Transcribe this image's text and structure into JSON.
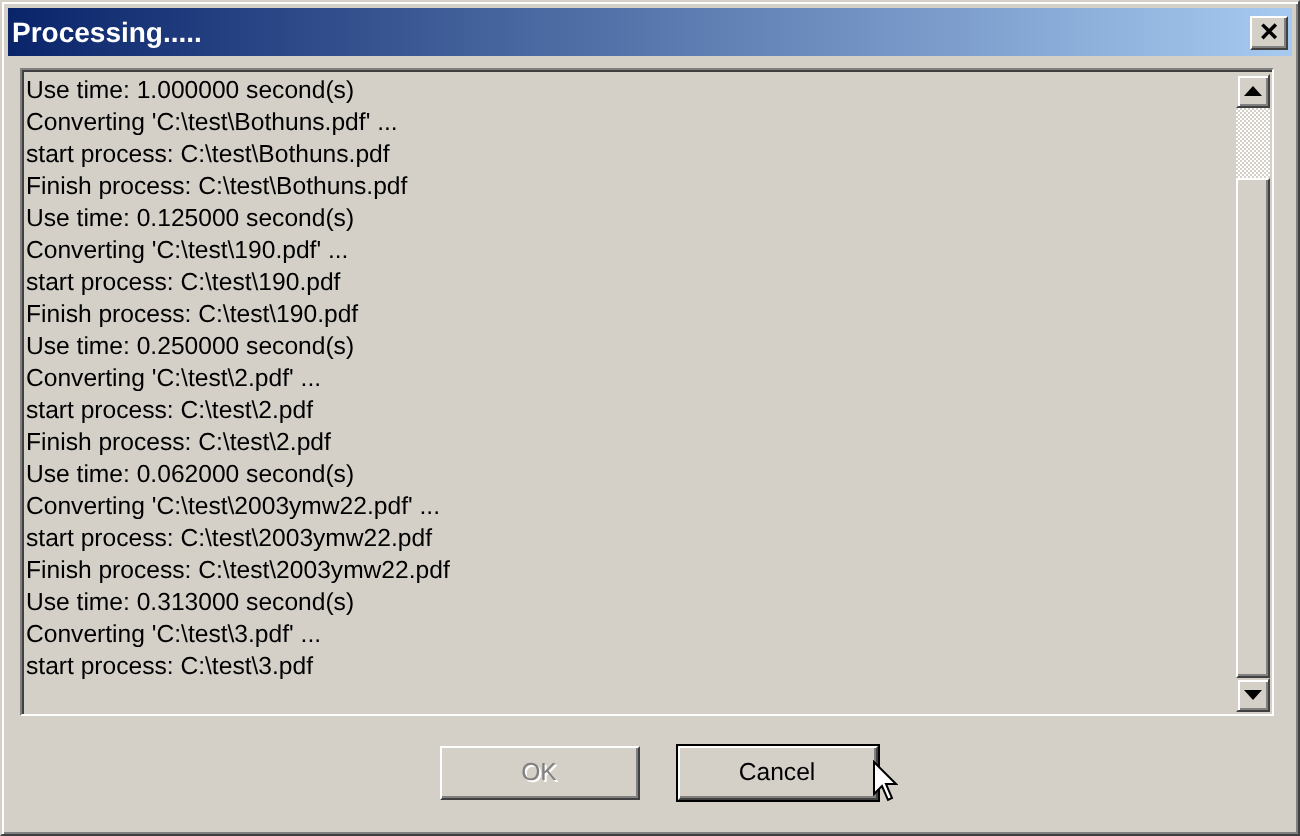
{
  "window": {
    "title": "Processing.....",
    "close": "×"
  },
  "log": [
    "Use time: 1.000000 second(s)",
    "Converting 'C:\\test\\Bothuns.pdf' ...",
    "start process: C:\\test\\Bothuns.pdf",
    "Finish process: C:\\test\\Bothuns.pdf",
    "Use time: 0.125000 second(s)",
    "Converting 'C:\\test\\190.pdf' ...",
    "start process: C:\\test\\190.pdf",
    "Finish process: C:\\test\\190.pdf",
    "Use time: 0.250000 second(s)",
    "Converting 'C:\\test\\2.pdf' ...",
    "start process: C:\\test\\2.pdf",
    "Finish process: C:\\test\\2.pdf",
    "Use time: 0.062000 second(s)",
    "Converting 'C:\\test\\2003ymw22.pdf' ...",
    "start process: C:\\test\\2003ymw22.pdf",
    "Finish process: C:\\test\\2003ymw22.pdf",
    "Use time: 0.313000 second(s)",
    "Converting 'C:\\test\\3.pdf' ...",
    "start process: C:\\test\\3.pdf"
  ],
  "buttons": [
    {
      "label": "OK",
      "disabled": true,
      "default": false
    },
    {
      "label": "Cancel",
      "disabled": false,
      "default": true
    }
  ]
}
